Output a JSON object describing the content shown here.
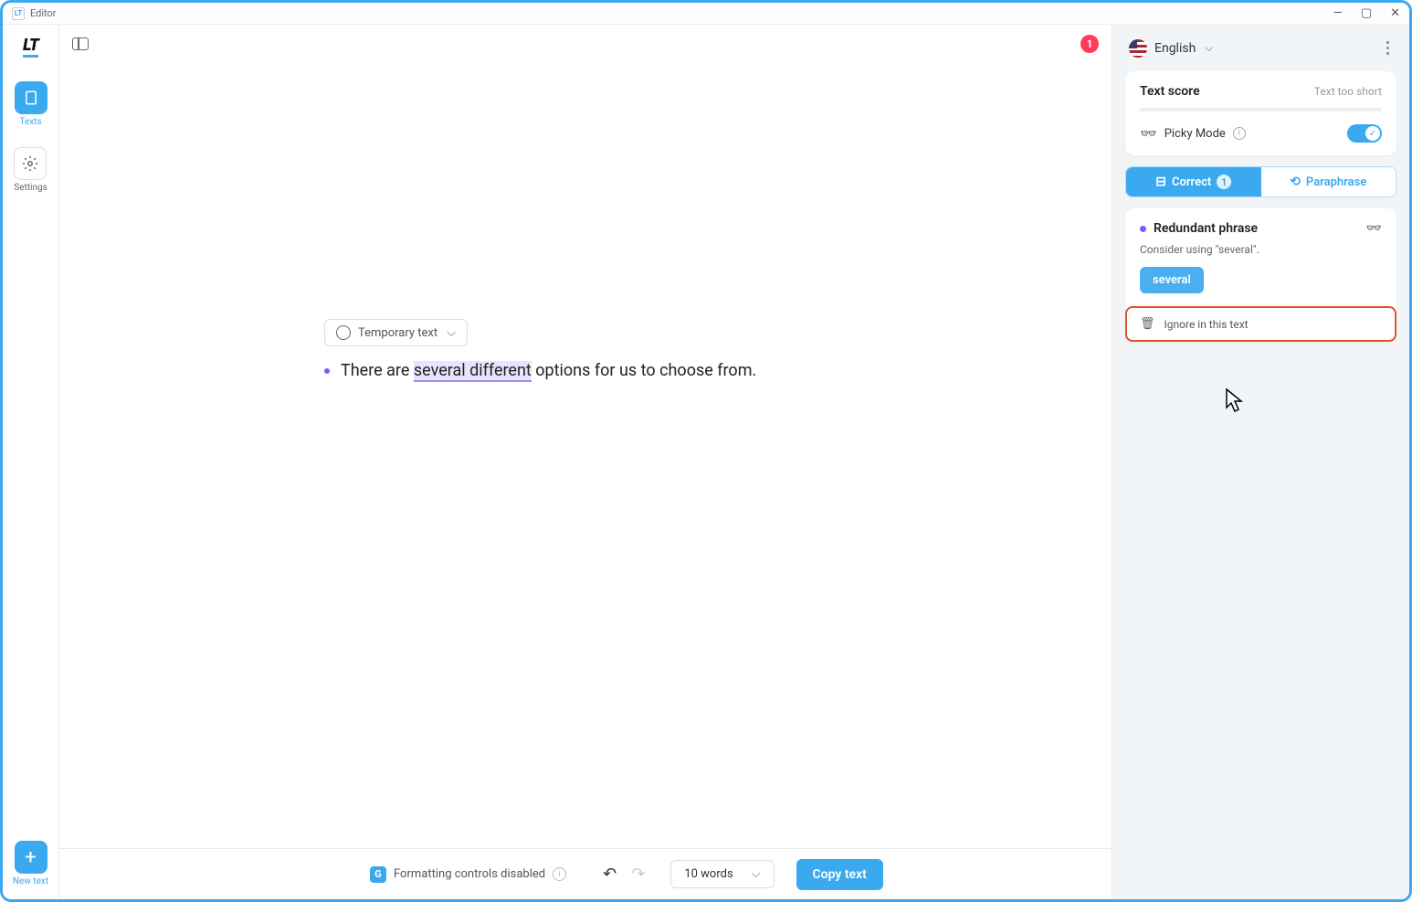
{
  "window": {
    "title": "Editor"
  },
  "sidebar": {
    "logo": "LT",
    "texts_label": "Texts",
    "settings_label": "Settings",
    "new_text_label": "New text"
  },
  "header": {
    "error_count": "1"
  },
  "editor": {
    "chip_label": "Temporary text",
    "sentence_prefix": "There are ",
    "sentence_highlight": "several different",
    "sentence_suffix": " options for us to choose from."
  },
  "bottombar": {
    "formatting_label": "Formatting controls disabled",
    "word_count": "10 words",
    "copy_label": "Copy text"
  },
  "rightpanel": {
    "language": "English",
    "score_title": "Text score",
    "score_hint": "Text too short",
    "picky_label": "Picky Mode",
    "tab_correct": "Correct",
    "tab_correct_count": "1",
    "tab_paraphrase": "Paraphrase",
    "issue": {
      "title": "Redundant phrase",
      "message": "Consider using \"several\".",
      "suggestion": "several",
      "ignore_label": "Ignore in this text"
    }
  }
}
